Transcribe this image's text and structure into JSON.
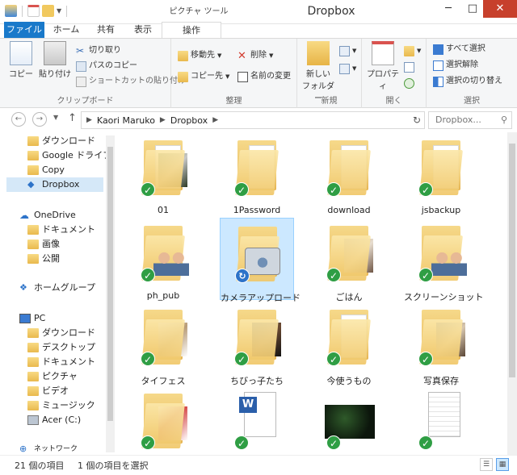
{
  "titlebar": {
    "contextual_title": "ピクチャ ツール",
    "window_title": "Dropbox",
    "minimize": "─",
    "maximize": "□",
    "close": "✕"
  },
  "tabs": {
    "file": "ファイル",
    "home": "ホーム",
    "share": "共有",
    "view": "表示",
    "manage": "操作"
  },
  "ribbon": {
    "clipboard": {
      "label": "クリップボード",
      "copy": "コピー",
      "paste": "貼り付け",
      "cut": "切り取り",
      "copy_path": "パスのコピー",
      "paste_shortcut": "ショートカットの貼り付け"
    },
    "organize": {
      "label": "整理",
      "move_to": "移動先",
      "copy_to": "コピー先",
      "delete": "削除",
      "rename": "名前の変更"
    },
    "new": {
      "label": "新規",
      "new_folder_line1": "新しい",
      "new_folder_line2": "フォルダー"
    },
    "open": {
      "label": "開く",
      "properties": "プロパティ"
    },
    "select": {
      "label": "選択",
      "select_all": "すべて選択",
      "select_none": "選択解除",
      "invert": "選択の切り替え"
    }
  },
  "address": {
    "crumbs": [
      "Kaori Maruko",
      "Dropbox"
    ],
    "search_placeholder": "Dropbox..."
  },
  "navpane": {
    "favorites": [
      "ダウンロード",
      "Google ドライブ",
      "Copy",
      "Dropbox"
    ],
    "onedrive": "OneDrive",
    "onedrive_items": [
      "ドキュメント",
      "画像",
      "公開"
    ],
    "homegroup": "ホームグループ",
    "pc": "PC",
    "pc_items": [
      "ダウンロード",
      "デスクトップ",
      "ドキュメント",
      "ピクチャ",
      "ビデオ",
      "ミュージック",
      "Acer (C:)"
    ],
    "network": "ネットワーク"
  },
  "files": [
    {
      "name": "01"
    },
    {
      "name": "1Password"
    },
    {
      "name": "download"
    },
    {
      "name": "jsbackup"
    },
    {
      "name": "ph_pub"
    },
    {
      "name": "カメラアップロード"
    },
    {
      "name": "ごはん"
    },
    {
      "name": "スクリーンショット"
    },
    {
      "name": "タイフェス"
    },
    {
      "name": "ちびっ子たち"
    },
    {
      "name": "今使うもの"
    },
    {
      "name": "写真保存"
    },
    {
      "name": ""
    },
    {
      "name": ""
    },
    {
      "name": ""
    },
    {
      "name": ""
    }
  ],
  "status": {
    "count": "21 個の項目",
    "selected": "1 個の項目を選択"
  },
  "colors": {
    "accent": "#1979ca",
    "sync_ok": "#2f9e44",
    "syncing": "#2d73c9",
    "selection": "#cce8ff"
  }
}
